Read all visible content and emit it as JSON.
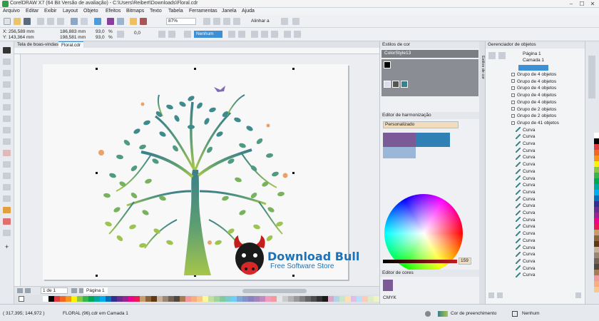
{
  "window": {
    "title": "CorelDRAW X7 (64 Bit Versão de avaliação) - C:\\Users\\Reibert\\Downloads\\Floral.cdr",
    "minimize": "–",
    "maximize": "☐",
    "close": "✕"
  },
  "menu": [
    "Arquivo",
    "Editar",
    "Exibir",
    "Layout",
    "Objeto",
    "Efeitos",
    "Bitmaps",
    "Texto",
    "Tabela",
    "Ferramentas",
    "Janela",
    "Ajuda"
  ],
  "toolbar": {
    "zoom": "87%",
    "align_label": "Alinhar a"
  },
  "property_bar": {
    "x": "X: 256,589 mm",
    "y": "Y: 143,364 mm",
    "w": "186,883 mm",
    "h": "198,581 mm",
    "scale_w": "93,0",
    "scale_h": "93,0",
    "percent": "%",
    "angle": "0,0",
    "outline": "Nenhum"
  },
  "document_tabs": [
    "Tela de boas-vindas",
    "Floral.cdr"
  ],
  "page_nav": {
    "count": "1 de 1",
    "page_tab": "Página 1"
  },
  "logo": {
    "title": "Download Bull",
    "subtitle": "Free Software Store"
  },
  "status": {
    "coords": "( 317,395; 144,972 )",
    "layer_info": "FLORAL (96).cdr em Camada 1",
    "fill_label": "Cor de preenchimento",
    "outline_label": "Nenhum"
  },
  "styles_panel": {
    "title": "Estilos de cor",
    "style_name": "ColorStyle13",
    "harmony_editor": "Editor de harmonização",
    "dropdown": "Personalizado",
    "color_value": "159",
    "color_editor": "Editor de cores",
    "bottom_label": "CMYK"
  },
  "object_manager": {
    "title": "Gerenciador de objetos",
    "page": "Página 1",
    "layer": "Camada 1",
    "groups": [
      "Grupo de 4 objetos",
      "Grupo de 4 objetos",
      "Grupo de 4 objetos",
      "Grupo de 4 objetos",
      "Grupo de 4 objetos",
      "Grupo de 2 objetos",
      "Grupo de 2 objetos",
      "Grupo de 41 objetos"
    ],
    "curves": [
      "Curva",
      "Curva",
      "Curva",
      "Curva",
      "Curva",
      "Curva",
      "Curva",
      "Curva",
      "Curva",
      "Curva",
      "Curva",
      "Curva",
      "Curva",
      "Curva",
      "Curva",
      "Curva",
      "Curva",
      "Curva",
      "Curva",
      "Curva",
      "Curva",
      "Curva"
    ]
  },
  "side_tab_label": "Estilos de cor",
  "colors": {
    "accent": "#3d8fd6",
    "tree_top": "#3a7f8a",
    "tree_bottom": "#a6c64a",
    "logo_blue": "#1e73b8"
  },
  "palette": [
    "#ffffff",
    "#000000",
    "#e03a3e",
    "#f26522",
    "#f7941d",
    "#fff200",
    "#8dc63f",
    "#39b54a",
    "#00a651",
    "#00a99d",
    "#00aeef",
    "#0072bc",
    "#2e3192",
    "#662d91",
    "#92278f",
    "#ec008c",
    "#ed145b",
    "#c69c6d",
    "#8c6239",
    "#603913",
    "#c7b299",
    "#998675",
    "#736357",
    "#534741",
    "#a67c52",
    "#f5989d",
    "#f9ad81",
    "#fdc68a",
    "#fff79a",
    "#c4df9b",
    "#a3d39c",
    "#82ca9d",
    "#7accc8",
    "#6dcff6",
    "#7da7d9",
    "#8393ca",
    "#8781bd",
    "#a186be",
    "#bd8cbf",
    "#f49ac1",
    "#f6989d",
    "#e6e6e6",
    "#cccccc",
    "#b3b3b3",
    "#999999",
    "#808080",
    "#666666",
    "#4d4d4d",
    "#333333",
    "#1a1a1a",
    "#d9a8c7",
    "#b5d3e7",
    "#c8e6c9",
    "#ffe0b2",
    "#e1bee7",
    "#bbdefb",
    "#ffccbc",
    "#dcedc8",
    "#f0f4c3",
    "#b2dfdb",
    "#cfd8dc",
    "#d7ccc8",
    "#f8bbd0",
    "#c5cae9",
    "#b3e5fc",
    "#c8e6c9",
    "#fff9c4",
    "#ffecb3",
    "#ffe0b2",
    "#ffccbc",
    "#f44336",
    "#e91e63",
    "#9c27b0",
    "#673ab7",
    "#3f51b5",
    "#2196f3",
    "#03a9f4",
    "#00bcd4",
    "#009688",
    "#4caf50",
    "#8bc34a",
    "#cddc39",
    "#ffeb3b",
    "#ffc107",
    "#ff9800",
    "#ff5722",
    "#795548",
    "#9e9e9e",
    "#607d8b",
    "#263238",
    "#880e4f",
    "#4a148c",
    "#1a237e",
    "#0d47a1",
    "#006064"
  ]
}
